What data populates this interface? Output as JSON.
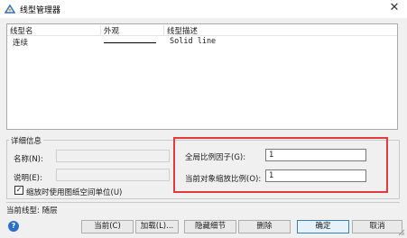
{
  "window": {
    "title": "线型管理器",
    "close_symbol": "✕"
  },
  "columns": [
    "线型名",
    "外观",
    "线型描述"
  ],
  "rows": [
    {
      "name": "连续",
      "description": "Solid line"
    }
  ],
  "details": {
    "group_label": "详细信息",
    "name_label": "名称(N):",
    "desc_label": "说明(E):",
    "paper_space_checkbox": {
      "label": "缩放时使用图纸空间单位(U)",
      "checked": true,
      "check_glyph": "✓"
    },
    "global_scale_label": "全局比例因子(G):",
    "global_scale_value": "1",
    "current_scale_label": "当前对象缩放比例(O):",
    "current_scale_value": "1"
  },
  "status": {
    "current_linetype": "当前线型: 随层"
  },
  "buttons": {
    "current": "当前(C)",
    "load": "加载(L)...",
    "hide_details": "隐藏细节",
    "delete": "删除",
    "ok": "确定",
    "cancel": "取消"
  },
  "help_glyph": "?",
  "colors": {
    "highlight": "#e23b3b",
    "help": "#2a6fc9"
  }
}
